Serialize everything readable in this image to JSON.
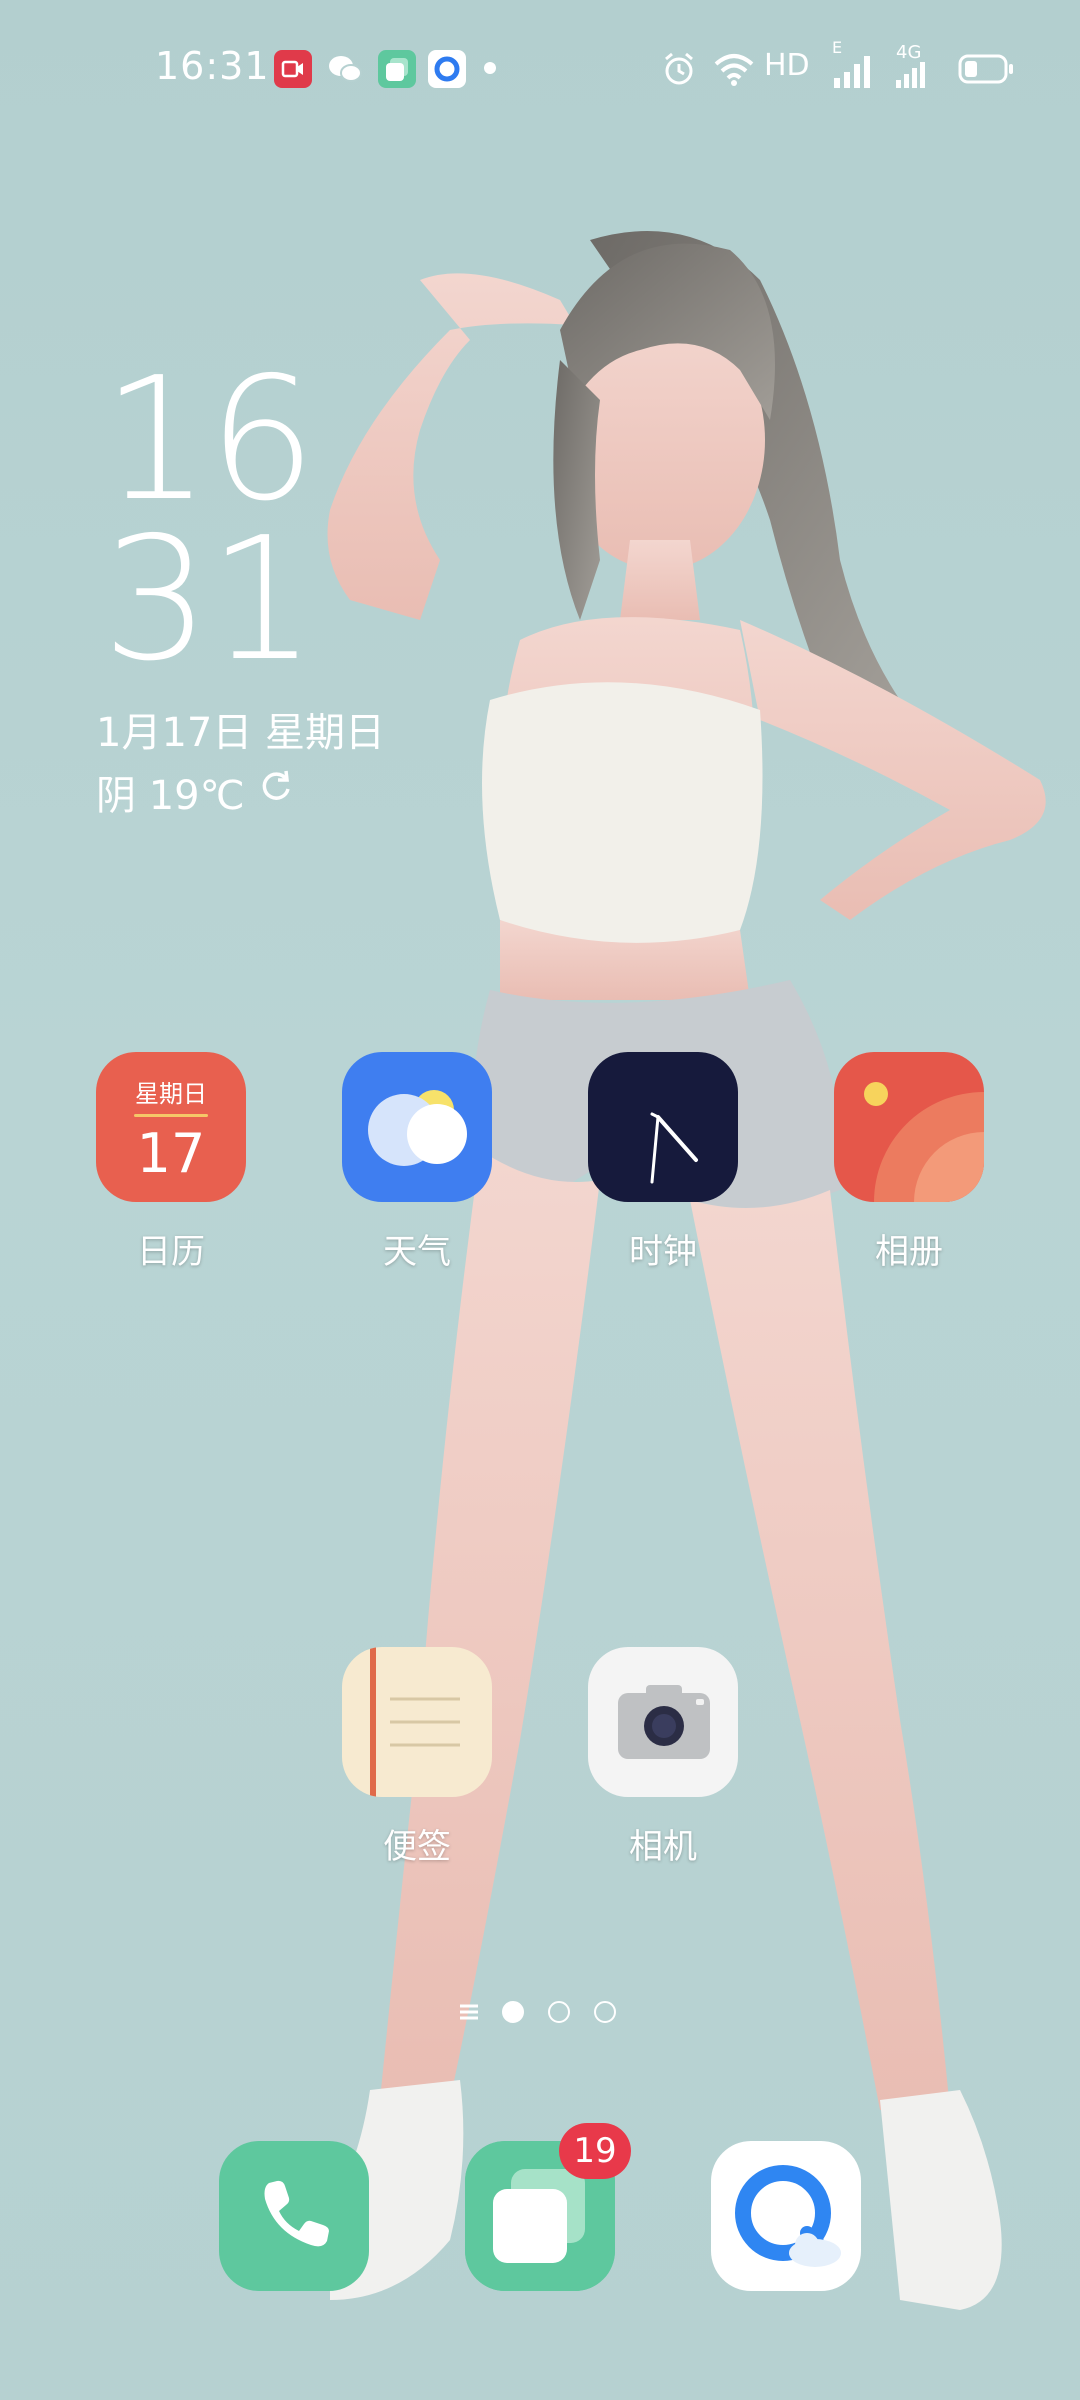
{
  "status_bar": {
    "time": "16:31",
    "network_label": "HD",
    "cell_e": "E",
    "cell_4g": "4G",
    "notifications": [
      "video-app-icon",
      "wechat-icon",
      "multi-window-icon",
      "browser-notification-icon",
      "more-dot-icon"
    ],
    "indicators": [
      "alarm-icon",
      "wifi-icon",
      "signal-icon",
      "signal-4g-icon",
      "battery-icon"
    ]
  },
  "clock_widget": {
    "hour": "16",
    "minute": "31",
    "date": "1月17日 星期日",
    "weather": "阴 19℃"
  },
  "apps": {
    "row1": [
      {
        "name": "calendar",
        "label": "日历",
        "weekday": "星期日",
        "day": "17"
      },
      {
        "name": "weather",
        "label": "天气"
      },
      {
        "name": "clock",
        "label": "时钟"
      },
      {
        "name": "gallery",
        "label": "相册"
      }
    ],
    "row2": [
      {
        "name": "notes",
        "label": "便签"
      },
      {
        "name": "camera",
        "label": "相机"
      }
    ]
  },
  "dock": {
    "apps": [
      {
        "name": "phone"
      },
      {
        "name": "messages",
        "badge": "19"
      },
      {
        "name": "qq-browser"
      }
    ]
  },
  "page_indicator": {
    "pages": 3,
    "active": 1
  },
  "colors": {
    "wallpaper": "#b6d1d1",
    "calendar": "#e8604f",
    "weather": "#3f7ef0",
    "clock": "#161a3c",
    "gallery": "#e5574a",
    "notes": "#f7ead0",
    "camera": "#f4f4f4",
    "phone": "#5ec89e",
    "badge": "#e8394a"
  }
}
